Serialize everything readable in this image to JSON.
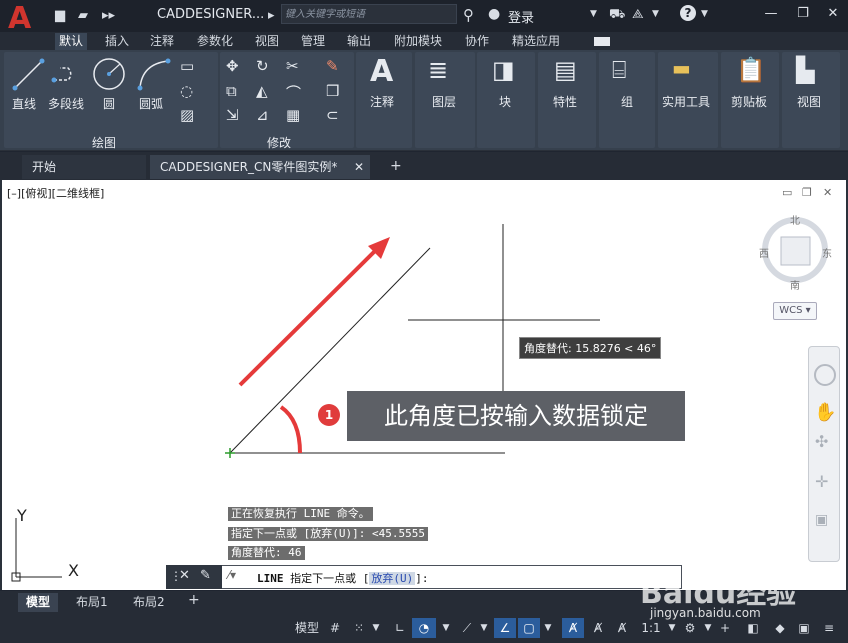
{
  "app": {
    "title": "CADDESIGNER...",
    "search_placeholder": "键入关键字或短语",
    "login": "登录",
    "accent": "#d0352e"
  },
  "ribbon_tabs": [
    "默认",
    "插入",
    "注释",
    "参数化",
    "视图",
    "管理",
    "输出",
    "附加模块",
    "协作",
    "精选应用"
  ],
  "draw_panel": {
    "tools": [
      "直线",
      "多段线",
      "圆",
      "圆弧"
    ],
    "label": "绘图"
  },
  "modify_panel": {
    "label": "修改"
  },
  "big_panels": [
    "注释",
    "图层",
    "块",
    "特性",
    "组",
    "实用工具",
    "剪贴板",
    "视图"
  ],
  "doc_tabs": {
    "start": "开始",
    "drawing": "CADDESIGNER_CN零件图实例*"
  },
  "viewport": {
    "label": "[–][俯视][二维线框]",
    "tooltip": "角度替代: 15.8276 < 46°",
    "callout_number": "1",
    "callout_text": "此角度已按输入数据锁定",
    "compass": {
      "north": "北",
      "south": "南",
      "east": "东",
      "west": "西",
      "wcs": "WCS"
    },
    "ucs": {
      "x": "X",
      "y": "Y"
    }
  },
  "command_history": [
    "正在恢复执行 LINE 命令。",
    "指定下一点或 [放弃(U)]: <45.5555",
    "角度替代: 46"
  ],
  "command_line": {
    "command": "LINE",
    "prompt": "指定下一点或 [",
    "option": "放弃(U)",
    "suffix": "]:"
  },
  "layout_tabs": [
    "模型",
    "布局1",
    "布局2"
  ],
  "status": {
    "model": "模型",
    "scale": "1:1"
  },
  "watermark": {
    "brand": "Baidu经验",
    "url": "jingyan.baidu.com"
  }
}
